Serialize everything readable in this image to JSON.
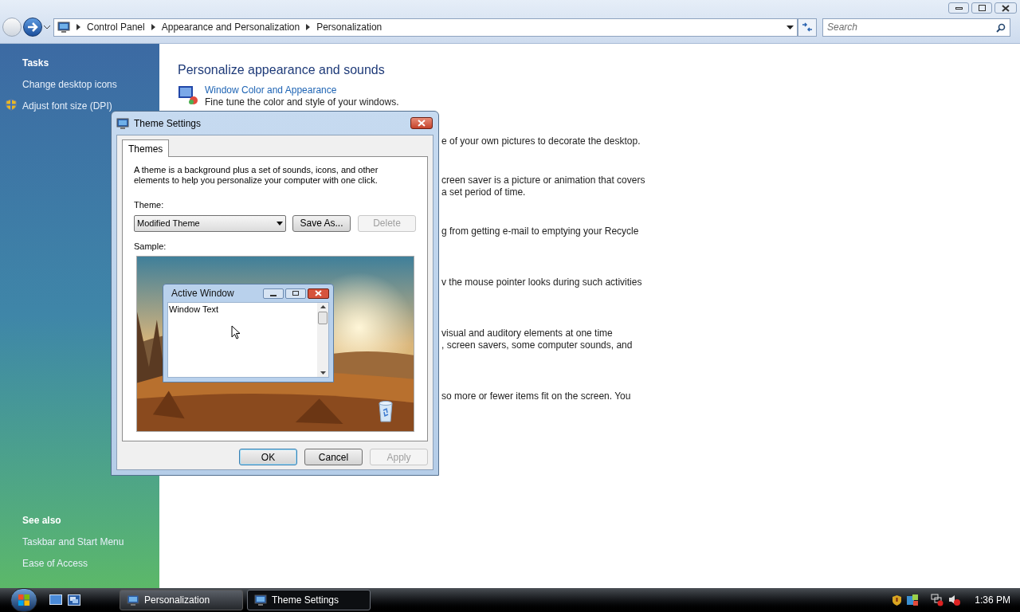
{
  "address_bar": {
    "breadcrumbs": [
      "Control Panel",
      "Appearance and Personalization",
      "Personalization"
    ]
  },
  "search": {
    "placeholder": "Search"
  },
  "sidebar": {
    "tasks_heading": "Tasks",
    "tasks": [
      {
        "label": "Change desktop icons",
        "kind": "link"
      },
      {
        "label": "Adjust font size (DPI)",
        "kind": "shield-link"
      }
    ],
    "see_also_heading": "See also",
    "see_also": [
      {
        "label": "Taskbar and Start Menu"
      },
      {
        "label": "Ease of Access"
      }
    ]
  },
  "main": {
    "heading": "Personalize appearance and sounds",
    "first_item": {
      "title": "Window Color and Appearance",
      "description": "Fine tune the color and style of your windows."
    },
    "fragments": [
      {
        "lines": [
          "e of your own pictures to decorate the desktop."
        ]
      },
      {
        "lines": [
          "creen saver is a picture or animation that covers",
          "a set period of time."
        ]
      },
      {
        "lines": [
          "g from getting e-mail to emptying your Recycle"
        ]
      },
      {
        "lines": [
          "v the mouse pointer looks during such activities"
        ]
      },
      {
        "lines": [
          "visual and auditory elements at one time",
          ", screen savers, some computer sounds, and"
        ]
      },
      {
        "lines": [
          "so more or fewer items fit on the screen. You"
        ]
      }
    ]
  },
  "dialog": {
    "title": "Theme Settings",
    "tabs": [
      {
        "label": "Themes",
        "selected": true
      }
    ],
    "intro": "A theme is a background plus a set of sounds, icons, and other elements to help you personalize your computer with one click.",
    "theme_label": "Theme:",
    "theme_value": "Modified Theme",
    "buttons": [
      {
        "label": "Save As...",
        "disabled": false
      },
      {
        "label": "Delete",
        "disabled": true
      }
    ],
    "sample_label": "Sample:",
    "preview": {
      "title": "Active Window",
      "text": "Window Text"
    },
    "footer_buttons": [
      {
        "label": "OK",
        "disabled": false,
        "default": true
      },
      {
        "label": "Cancel",
        "disabled": false,
        "default": false
      },
      {
        "label": "Apply",
        "disabled": true,
        "default": false
      }
    ]
  },
  "taskbar": {
    "tasks": [
      {
        "label": "Personalization",
        "selected": false
      },
      {
        "label": "Theme Settings",
        "selected": true
      }
    ],
    "clock": "1:36 PM"
  }
}
